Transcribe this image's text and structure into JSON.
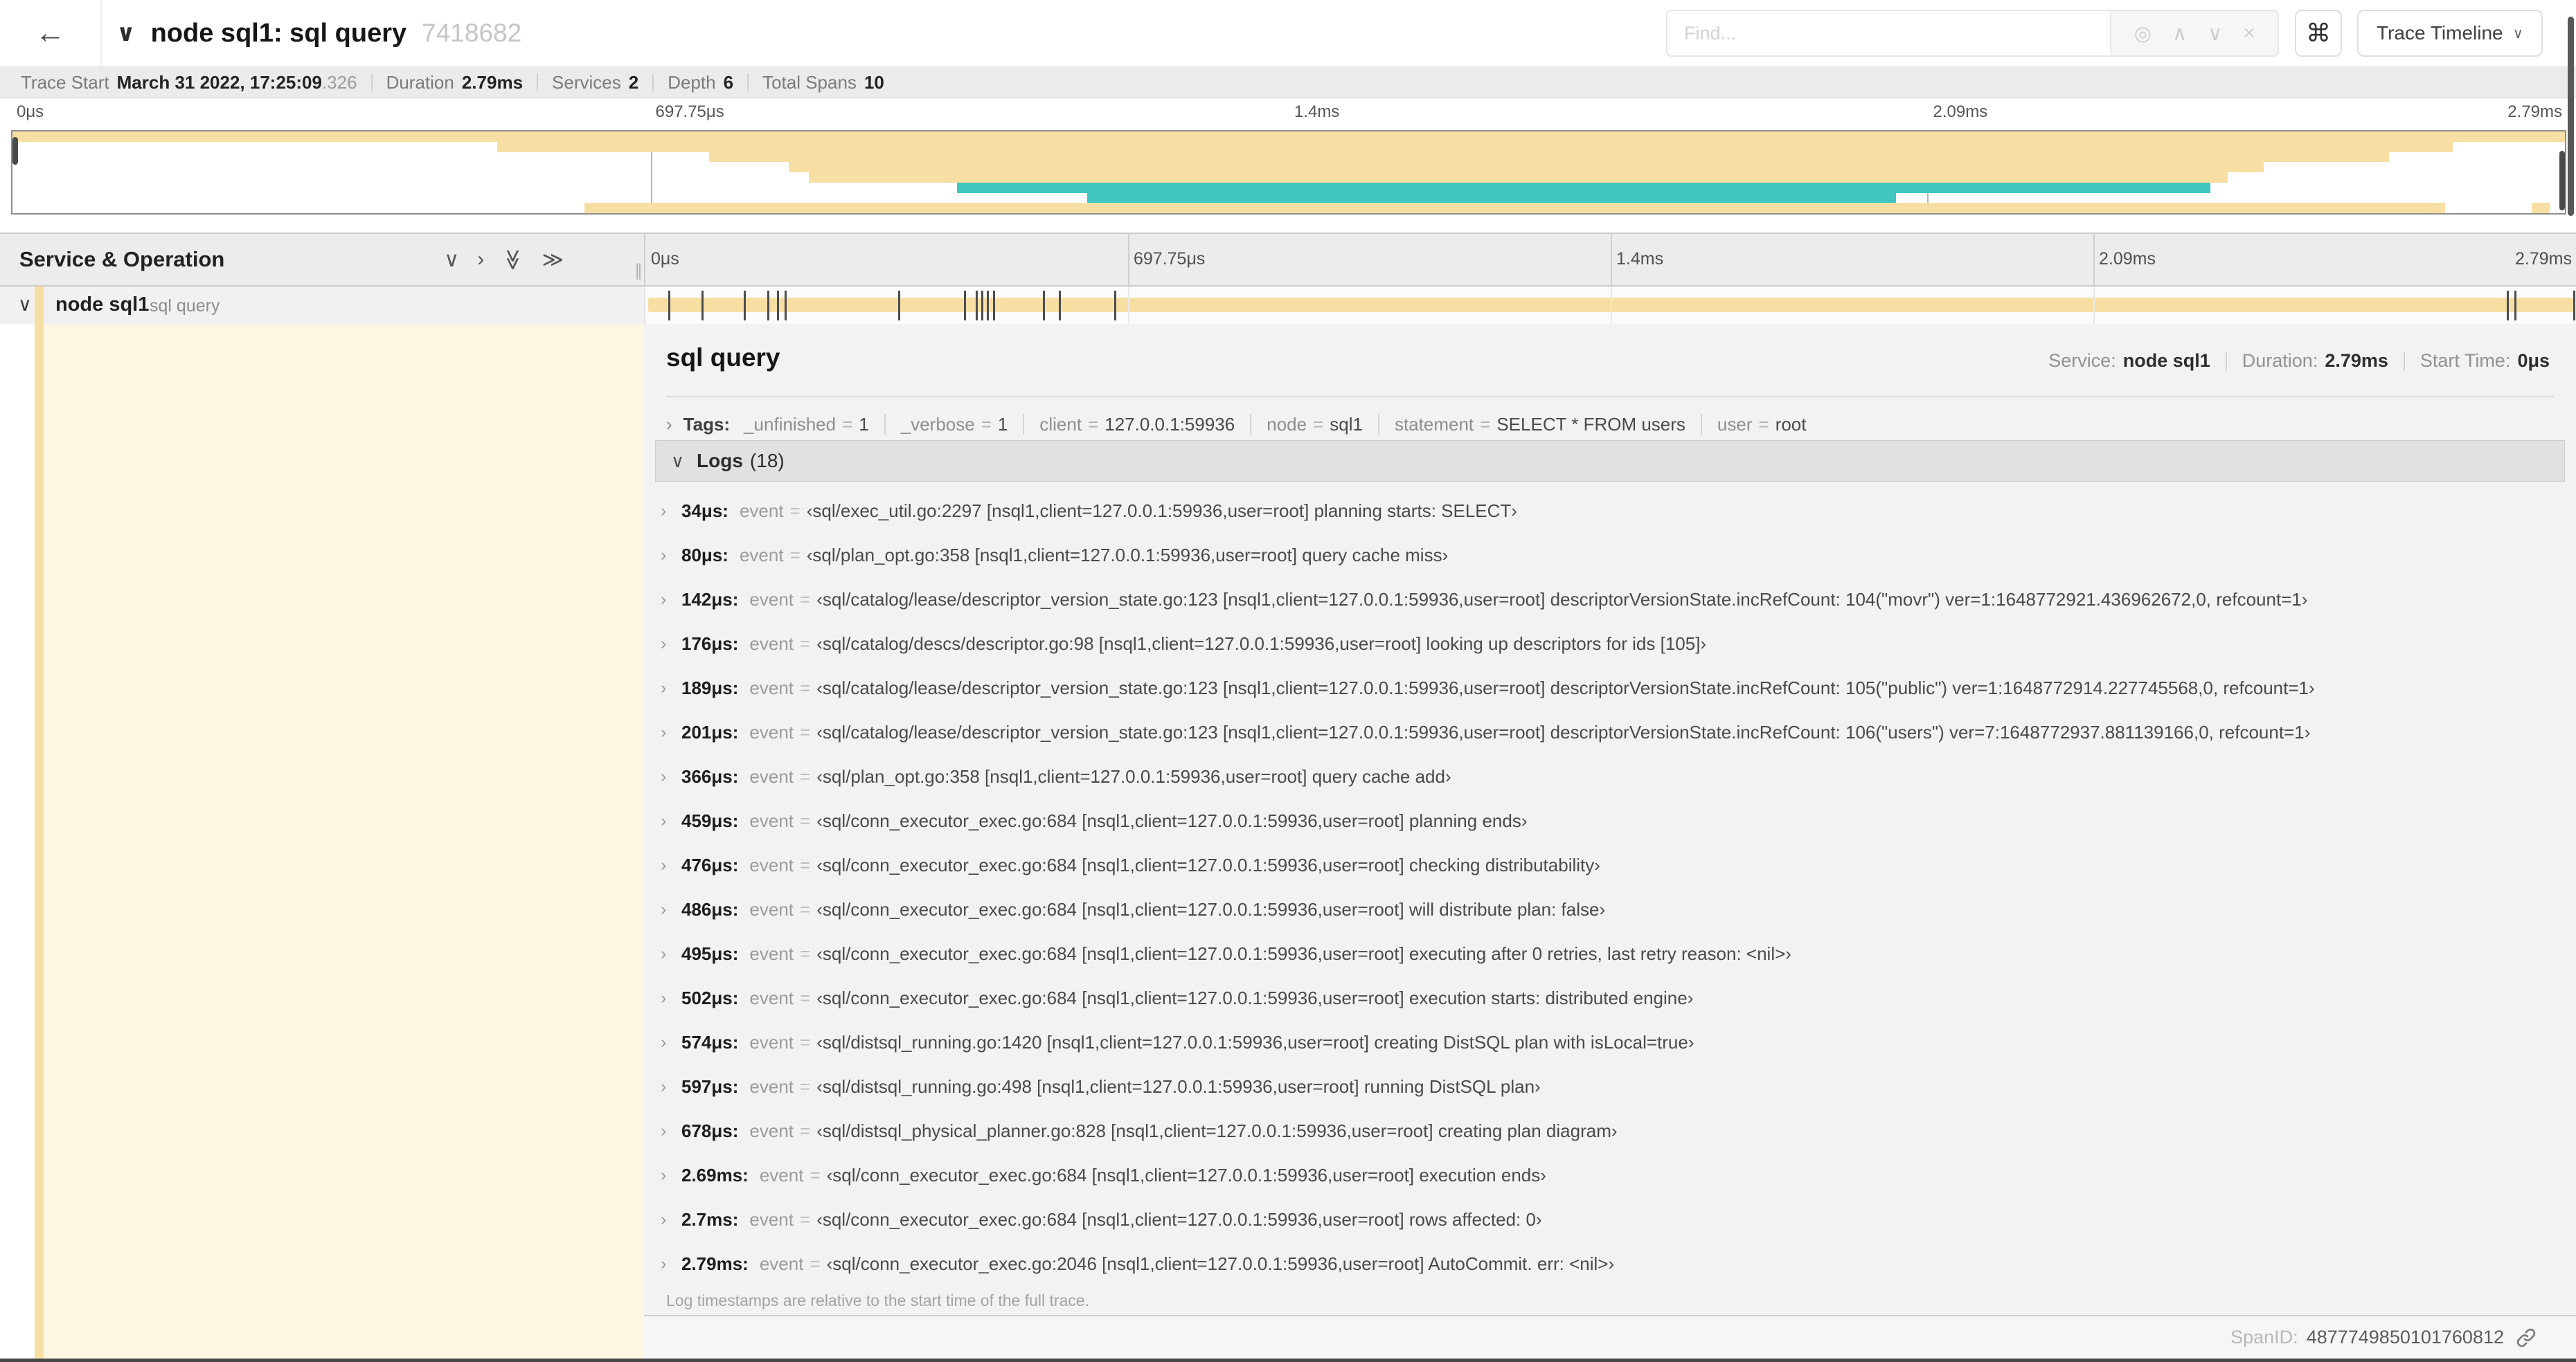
{
  "symbols": {
    "eq": "=",
    "dot_suffix": true
  },
  "icons": {
    "back": "←",
    "chevron_down": "∨",
    "chevron_right": "›",
    "chevron_double": "≫",
    "locate": "◎",
    "up_chevron": "∧",
    "down_chevron": "∨",
    "close": "×",
    "command": "⌘",
    "resizer": "∥"
  },
  "colors": {
    "tan": "#f7dfa4",
    "teal": "#3fc6c0",
    "cream": "#fdf6e3",
    "marker": "#4c4c50"
  },
  "header": {
    "title": "node sql1: sql query",
    "trace_id": "7418682",
    "find_placeholder": "Find...",
    "view_selector_label": "Trace Timeline"
  },
  "trace_info": {
    "items": [
      {
        "label": "Trace Start",
        "value": "March 31 2022, 17:25:09",
        "suffix": ".326"
      },
      {
        "label": "Duration",
        "value": "2.79ms"
      },
      {
        "label": "Services",
        "value": "2"
      },
      {
        "label": "Depth",
        "value": "6"
      },
      {
        "label": "Total Spans",
        "value": "10"
      }
    ]
  },
  "axis_ticks": [
    {
      "label": "0μs",
      "pct": 0
    },
    {
      "label": "697.75μs",
      "pct": 25
    },
    {
      "label": "1.4ms",
      "pct": 50
    },
    {
      "label": "2.09ms",
      "pct": 75
    },
    {
      "label": "2.79ms",
      "pct": 100
    }
  ],
  "minimap": {
    "rows": [
      {
        "row": 0,
        "start": 0,
        "end": 100,
        "color": "tan"
      },
      {
        "row": 1,
        "start": 19.0,
        "end": 95.6,
        "color": "tan"
      },
      {
        "row": 2,
        "start": 27.3,
        "end": 93.1,
        "color": "tan"
      },
      {
        "row": 3,
        "start": 30.4,
        "end": 88.2,
        "color": "tan"
      },
      {
        "row": 4,
        "start": 31.2,
        "end": 86.8,
        "color": "tan"
      },
      {
        "row": 5,
        "start": 37.0,
        "end": 86.1,
        "color": "teal"
      },
      {
        "row": 6,
        "start": 42.1,
        "end": 73.8,
        "color": "teal"
      },
      {
        "row": 7,
        "start": 22.4,
        "end": 95.3,
        "color": "tan"
      },
      {
        "row": 7,
        "start": 98.7,
        "end": 99.4,
        "color": "tan"
      }
    ]
  },
  "timeline": {
    "column_header": "Service & Operation",
    "row": {
      "service": "node sql1",
      "operation": "sql query",
      "log_marker_pcts": [
        1.2,
        2.9,
        5.1,
        6.3,
        6.8,
        7.2,
        13.1,
        16.5,
        17.1,
        17.4,
        17.7,
        18.0,
        20.6,
        21.4,
        24.3,
        96.4,
        96.8,
        99.85
      ]
    }
  },
  "detail": {
    "title": "sql query",
    "meta": [
      {
        "label": "Service:",
        "value": "node sql1"
      },
      {
        "label": "Duration:",
        "value": "2.79ms"
      },
      {
        "label": "Start Time:",
        "value": "0μs"
      }
    ],
    "tags_label": "Tags:",
    "tags": [
      {
        "key": "_unfinished",
        "value": "1"
      },
      {
        "key": "_verbose",
        "value": "1"
      },
      {
        "key": "client",
        "value": "127.0.0.1:59936"
      },
      {
        "key": "node",
        "value": "sql1"
      },
      {
        "key": "statement",
        "value": "SELECT * FROM users"
      },
      {
        "key": "user",
        "value": "root"
      }
    ],
    "logs_label": "Logs",
    "logs_count": "(18)",
    "logs": [
      {
        "time": "34μs:",
        "field": "event",
        "value": "‹sql/exec_util.go:2297 [nsql1,client=127.0.0.1:59936,user=root] planning starts: SELECT›"
      },
      {
        "time": "80μs:",
        "field": "event",
        "value": "‹sql/plan_opt.go:358 [nsql1,client=127.0.0.1:59936,user=root] query cache miss›"
      },
      {
        "time": "142μs:",
        "field": "event",
        "value": "‹sql/catalog/lease/descriptor_version_state.go:123 [nsql1,client=127.0.0.1:59936,user=root] descriptorVersionState.incRefCount: 104(\"movr\") ver=1:1648772921.436962672,0, refcount=1›"
      },
      {
        "time": "176μs:",
        "field": "event",
        "value": "‹sql/catalog/descs/descriptor.go:98 [nsql1,client=127.0.0.1:59936,user=root] looking up descriptors for ids [105]›"
      },
      {
        "time": "189μs:",
        "field": "event",
        "value": "‹sql/catalog/lease/descriptor_version_state.go:123 [nsql1,client=127.0.0.1:59936,user=root] descriptorVersionState.incRefCount: 105(\"public\") ver=1:1648772914.227745568,0, refcount=1›"
      },
      {
        "time": "201μs:",
        "field": "event",
        "value": "‹sql/catalog/lease/descriptor_version_state.go:123 [nsql1,client=127.0.0.1:59936,user=root] descriptorVersionState.incRefCount: 106(\"users\") ver=7:1648772937.881139166,0, refcount=1›"
      },
      {
        "time": "366μs:",
        "field": "event",
        "value": "‹sql/plan_opt.go:358 [nsql1,client=127.0.0.1:59936,user=root] query cache add›"
      },
      {
        "time": "459μs:",
        "field": "event",
        "value": "‹sql/conn_executor_exec.go:684 [nsql1,client=127.0.0.1:59936,user=root] planning ends›"
      },
      {
        "time": "476μs:",
        "field": "event",
        "value": "‹sql/conn_executor_exec.go:684 [nsql1,client=127.0.0.1:59936,user=root] checking distributability›"
      },
      {
        "time": "486μs:",
        "field": "event",
        "value": "‹sql/conn_executor_exec.go:684 [nsql1,client=127.0.0.1:59936,user=root] will distribute plan: false›"
      },
      {
        "time": "495μs:",
        "field": "event",
        "value": "‹sql/conn_executor_exec.go:684 [nsql1,client=127.0.0.1:59936,user=root] executing after 0 retries, last retry reason: <nil>›"
      },
      {
        "time": "502μs:",
        "field": "event",
        "value": "‹sql/conn_executor_exec.go:684 [nsql1,client=127.0.0.1:59936,user=root] execution starts: distributed engine›"
      },
      {
        "time": "574μs:",
        "field": "event",
        "value": "‹sql/distsql_running.go:1420 [nsql1,client=127.0.0.1:59936,user=root] creating DistSQL plan with isLocal=true›"
      },
      {
        "time": "597μs:",
        "field": "event",
        "value": "‹sql/distsql_running.go:498 [nsql1,client=127.0.0.1:59936,user=root] running DistSQL plan›"
      },
      {
        "time": "678μs:",
        "field": "event",
        "value": "‹sql/distsql_physical_planner.go:828 [nsql1,client=127.0.0.1:59936,user=root] creating plan diagram›"
      },
      {
        "time": "2.69ms:",
        "field": "event",
        "value": "‹sql/conn_executor_exec.go:684 [nsql1,client=127.0.0.1:59936,user=root] execution ends›"
      },
      {
        "time": "2.7ms:",
        "field": "event",
        "value": "‹sql/conn_executor_exec.go:684 [nsql1,client=127.0.0.1:59936,user=root] rows affected: 0›"
      },
      {
        "time": "2.79ms:",
        "field": "event",
        "value": "‹sql/conn_executor_exec.go:2046 [nsql1,client=127.0.0.1:59936,user=root] AutoCommit. err: <nil>›"
      }
    ],
    "footnote": "Log timestamps are relative to the start time of the full trace.",
    "span_id_label": "SpanID:",
    "span_id": "4877749850101760812"
  }
}
